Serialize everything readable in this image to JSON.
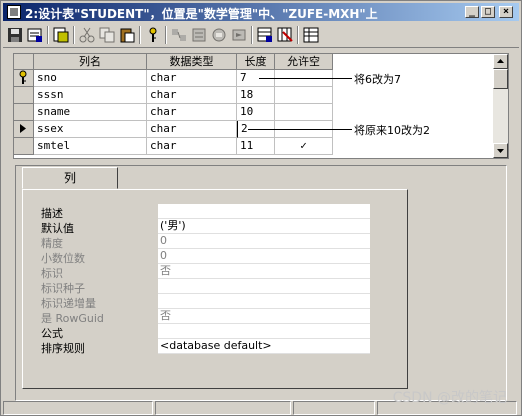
{
  "window": {
    "title": "2:设计表\"STUDENT\"，位置是\"数学管理\"中、\"ZUFE-MXH\"上",
    "minimize_glyph": "_",
    "maximize_glyph": "□",
    "close_glyph": "×"
  },
  "toolbar": {
    "buttons": [
      {
        "icon": "save-icon",
        "enabled": true
      },
      {
        "icon": "properties-icon",
        "enabled": true
      },
      {
        "icon": "change-script-icon",
        "enabled": true
      },
      {
        "icon": "cut-icon",
        "enabled": false
      },
      {
        "icon": "copy-icon",
        "enabled": false
      },
      {
        "icon": "paste-icon",
        "enabled": true
      },
      {
        "icon": "primary-key-icon",
        "enabled": true
      },
      {
        "icon": "manage-relationships-icon",
        "enabled": false
      },
      {
        "icon": "manage-indexes-icon",
        "enabled": false
      },
      {
        "icon": "manage-constraints-icon",
        "enabled": false
      },
      {
        "icon": "manage-triggers-icon",
        "enabled": false
      },
      {
        "icon": "insert-column-icon",
        "enabled": true
      },
      {
        "icon": "delete-column-icon",
        "enabled": true
      },
      {
        "icon": "table-view-icon",
        "enabled": true
      }
    ]
  },
  "grid": {
    "headers": [
      "列名",
      "数据类型",
      "长度",
      "允许空"
    ],
    "rows": [
      {
        "name": "sno",
        "type": "char",
        "length": "7",
        "nullable": "",
        "key": true,
        "current": false
      },
      {
        "name": "sssn",
        "type": "char",
        "length": "18",
        "nullable": "",
        "key": false,
        "current": false
      },
      {
        "name": "sname",
        "type": "char",
        "length": "10",
        "nullable": "",
        "key": false,
        "current": false
      },
      {
        "name": "ssex",
        "type": "char",
        "length": "2",
        "nullable": "",
        "key": false,
        "current": true
      },
      {
        "name": "smtel",
        "type": "char",
        "length": "11",
        "nullable": "✓",
        "key": false,
        "current": false
      }
    ],
    "annotations": [
      {
        "text": "将6改为7",
        "row": 0
      },
      {
        "text": "将原来10改为2",
        "row": 3
      }
    ]
  },
  "properties": {
    "tab_label": "列",
    "items": [
      {
        "label": "描述",
        "value": "",
        "enabled": true
      },
      {
        "label": "默认值",
        "value": "('男')",
        "enabled": true
      },
      {
        "label": "精度",
        "value": "0",
        "enabled": false
      },
      {
        "label": "小数位数",
        "value": "0",
        "enabled": false
      },
      {
        "label": "标识",
        "value": "否",
        "enabled": false
      },
      {
        "label": "标识种子",
        "value": "",
        "enabled": false
      },
      {
        "label": "标识递增量",
        "value": "",
        "enabled": false
      },
      {
        "label": "是 RowGuid",
        "value": "否",
        "enabled": false
      },
      {
        "label": "公式",
        "value": "",
        "enabled": true
      },
      {
        "label": "排序规则",
        "value": "<database default>",
        "enabled": true
      }
    ]
  },
  "watermark": "CSDN @改的笔记"
}
